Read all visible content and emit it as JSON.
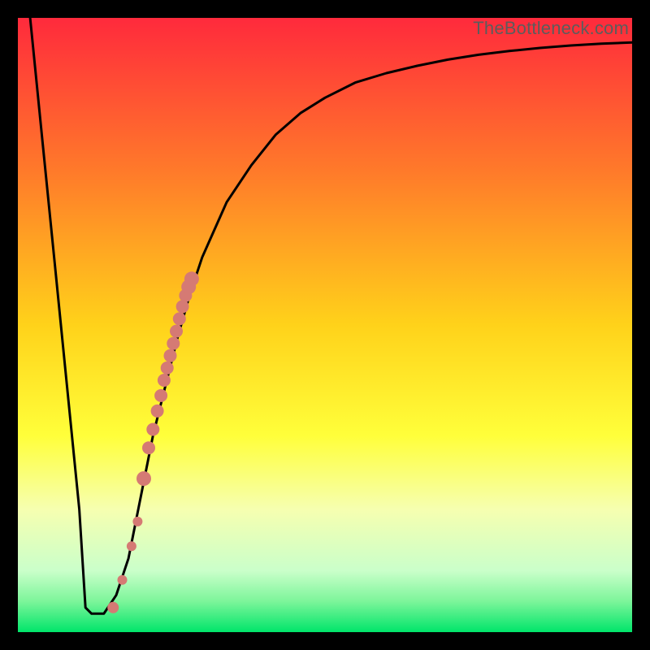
{
  "watermark": "TheBottleneck.com",
  "chart_data": {
    "type": "line",
    "title": "",
    "xlabel": "",
    "ylabel": "",
    "xlim": [
      0,
      100
    ],
    "ylim": [
      0,
      100
    ],
    "gradient_stops": [
      {
        "offset": 0.0,
        "color": "#ff2a3c"
      },
      {
        "offset": 0.25,
        "color": "#ff7a2a"
      },
      {
        "offset": 0.5,
        "color": "#ffd21a"
      },
      {
        "offset": 0.68,
        "color": "#ffff3a"
      },
      {
        "offset": 0.8,
        "color": "#f6ffb0"
      },
      {
        "offset": 0.9,
        "color": "#caffca"
      },
      {
        "offset": 0.95,
        "color": "#7cf59a"
      },
      {
        "offset": 1.0,
        "color": "#00e56a"
      }
    ],
    "series": [
      {
        "name": "bottleneck-curve",
        "type": "line",
        "x": [
          2.0,
          4.0,
          6.0,
          8.0,
          10.0,
          11.0,
          12.0,
          14.0,
          16.0,
          18.0,
          20.0,
          22.0,
          24.0,
          26.0,
          28.0,
          30.0,
          34.0,
          38.0,
          42.0,
          46.0,
          50.0,
          55.0,
          60.0,
          65.0,
          70.0,
          75.0,
          80.0,
          85.0,
          90.0,
          95.0,
          100.0
        ],
        "y": [
          100.0,
          80.0,
          60.0,
          40.0,
          20.0,
          4.0,
          3.0,
          3.0,
          6.0,
          12.0,
          22.0,
          32.0,
          40.0,
          48.0,
          55.0,
          61.0,
          70.0,
          76.0,
          81.0,
          84.5,
          87.0,
          89.5,
          91.0,
          92.2,
          93.2,
          94.0,
          94.6,
          95.1,
          95.5,
          95.8,
          96.0
        ]
      },
      {
        "name": "highlighted-points",
        "type": "scatter",
        "x": [
          15.5,
          17.0,
          18.5,
          19.5,
          20.5,
          21.3,
          22.0,
          22.7,
          23.3,
          23.8,
          24.3,
          24.8,
          25.3,
          25.8,
          26.3,
          26.8,
          27.3,
          27.8,
          28.3
        ],
        "y": [
          4.0,
          8.5,
          14.0,
          18.0,
          25.0,
          30.0,
          33.0,
          36.0,
          38.5,
          41.0,
          43.0,
          45.0,
          47.0,
          49.0,
          51.0,
          53.0,
          54.8,
          56.2,
          57.5
        ]
      }
    ],
    "marker_sizes": [
      7,
      6,
      6,
      6,
      9,
      8,
      8,
      8,
      8,
      8,
      8,
      8,
      8,
      8,
      8,
      8,
      8,
      9,
      9
    ],
    "marker_color": "#d57a74",
    "curve_color": "#000000",
    "curve_width": 3
  }
}
